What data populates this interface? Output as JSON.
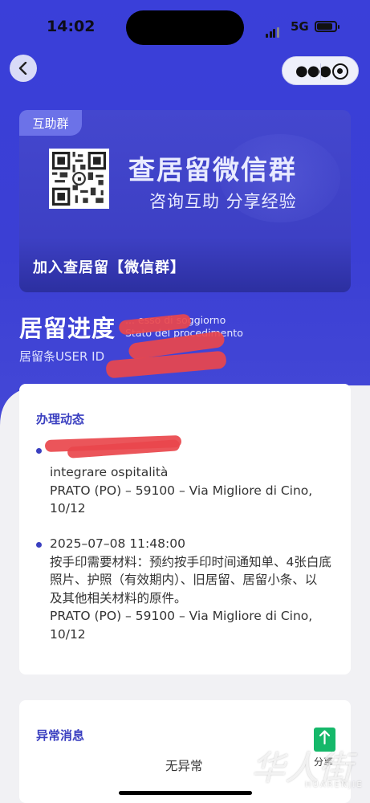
{
  "status_bar": {
    "time": "14:02",
    "network": "5G",
    "battery_level": 0.85
  },
  "nav": {
    "back_icon": "chevron-left-icon",
    "more_icon": "more-dots-icon",
    "close_icon": "mini-program-close-icon"
  },
  "banner": {
    "tag": "互助群",
    "title": "查居留微信群",
    "subtitle": "咨询互助 分享经验",
    "join_link": "加入查居留【微信群】"
  },
  "residence": {
    "title": "居留进度",
    "status_label_1": "... esso di soggiorno",
    "status_label_2": "Stato del procedimento",
    "user_id_label": "居留条USER ID"
  },
  "progress_card": {
    "title": "办理动态",
    "items": [
      {
        "datetime": "",
        "lines": [
          "integrare ospitalità",
          "PRATO (PO) – 59100 – Via Migliore di Cino,",
          "10/12"
        ]
      },
      {
        "datetime": "2025–07–08 11:48:00",
        "lines": [
          "按手印需要材料：预约按手印时间通知单、4张白底",
          "照片、护照（有效期内）、旧居留、居留小条、以",
          "及其他相关材料的原件。",
          "PRATO (PO) – 59100 – Via Migliore di Cino,",
          "10/12"
        ]
      }
    ]
  },
  "exception_card": {
    "title": "异常消息",
    "value": "无异常"
  },
  "share": {
    "label": "分享",
    "icon": "share-upload-icon"
  },
  "watermark": {
    "text": "华人街",
    "sub": "HUARENJIE"
  },
  "colors": {
    "primary": "#3a3fd9",
    "accent": "#3a3fc0",
    "redaction": "#e9464c",
    "share_green": "#15b86a"
  }
}
